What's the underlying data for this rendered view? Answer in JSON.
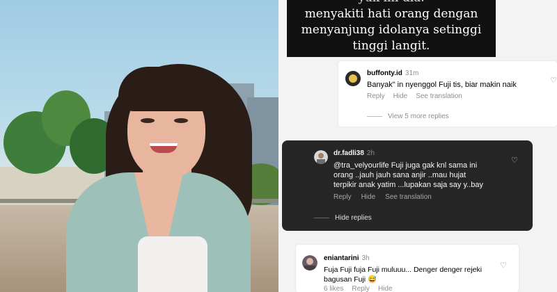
{
  "story": {
    "line0": "yuk ini dia.",
    "line1": "menyakiti hati orang dengan",
    "line2": "menyanjung idolanya setinggi",
    "line3": "tinggi langit."
  },
  "comments": [
    {
      "username": "buffonty.id",
      "time": "31m",
      "text": "Banyak\" in nyenggol Fuji tis, biar makin naik",
      "reply": "Reply",
      "hide": "Hide",
      "translate": "See translation",
      "more_replies": "View 5 more replies"
    },
    {
      "username": "dr.fadli38",
      "time": "2h",
      "text_lines": [
        "@tra_velyourlife Fuji juga gak knl sama ini",
        "orang ..jauh jauh sana anjir ..mau hujat",
        "terpikir anak yatim ...lupakan saja say y..bay"
      ],
      "reply": "Reply",
      "hide": "Hide",
      "translate": "See translation",
      "hide_replies": "Hide replies"
    },
    {
      "username": "eniantarini",
      "time": "3h",
      "text_lines": [
        "Fuja Fuji fuja Fuji muluuu... Denger denger rejeki",
        "bagusan Fuji 😅"
      ],
      "likes": "6 likes",
      "reply": "Reply",
      "hide": "Hide"
    }
  ],
  "icons": {
    "heart": "heart-icon"
  }
}
